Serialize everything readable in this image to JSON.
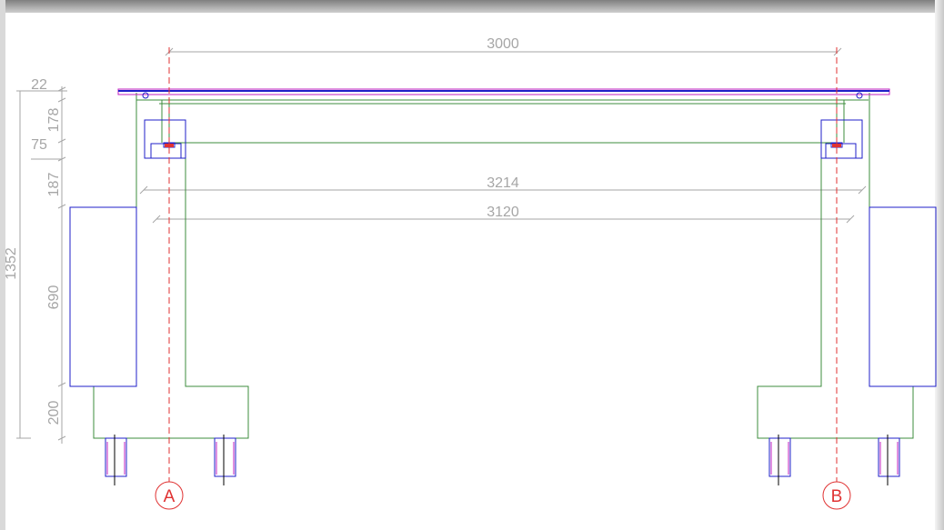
{
  "drawing": {
    "dimensions": {
      "span_axes": "3000",
      "span_outer": "3214",
      "span_inner": "3120",
      "height_total": "1352",
      "deck": "22",
      "beam": "178",
      "bearing": "75",
      "cap": "187",
      "wall": "690",
      "footing": "200"
    },
    "axes": {
      "left": "A",
      "right": "B"
    }
  },
  "colors": {
    "dimension": "#a6a6a6",
    "concrete": "#3c8c3c",
    "block": "#1f1fc8",
    "axis": "#e03232",
    "deck": "#c020c0"
  }
}
